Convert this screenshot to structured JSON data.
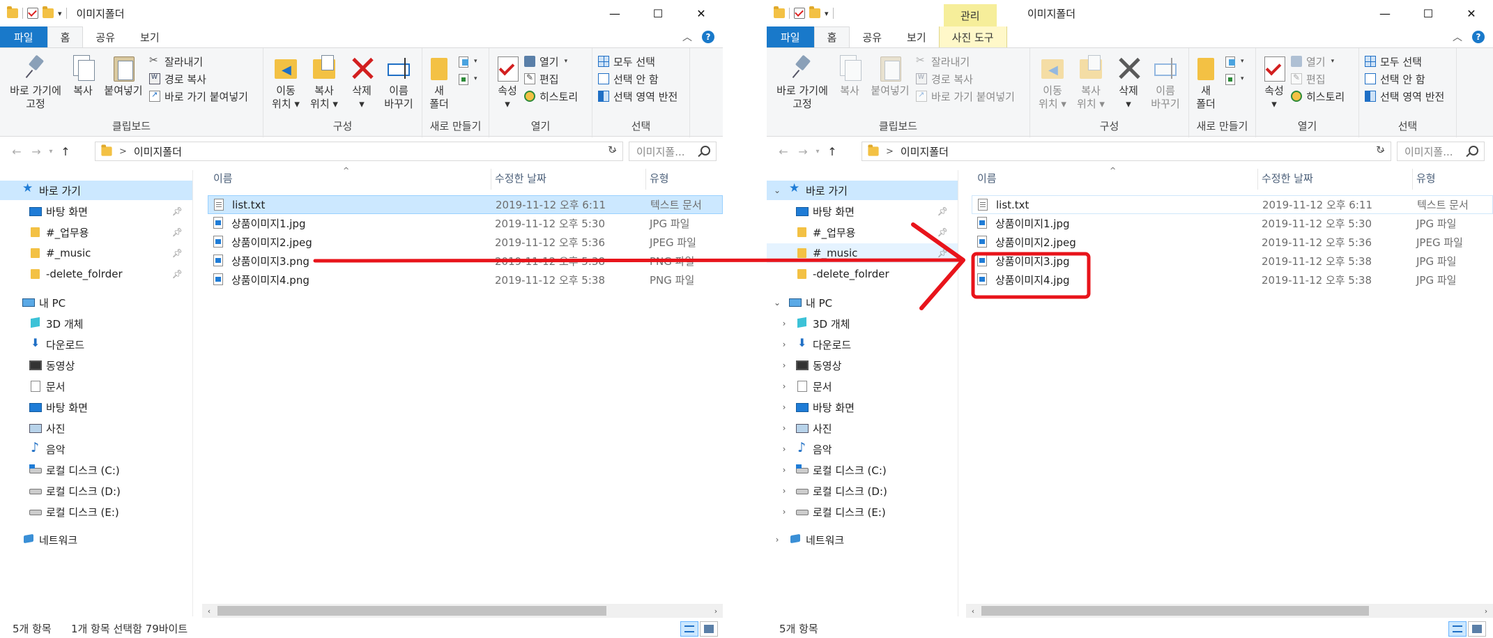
{
  "left": {
    "title": "이미지폴더",
    "tabs": [
      "파일",
      "홈",
      "공유",
      "보기"
    ],
    "clipboard": {
      "pin": "바로 가기에\n고정",
      "copy": "복사",
      "paste": "붙여넣기",
      "cut": "잘라내기",
      "copy_path": "경로 복사",
      "paste_shortcut": "바로 가기 붙여넣기",
      "label": "클립보드"
    },
    "organize": {
      "move_to": "이동\n위치 ▾",
      "copy_to": "복사\n위치 ▾",
      "delete": "삭제\n▾",
      "rename": "이름\n바꾸기",
      "label": "구성"
    },
    "new": {
      "new_folder": "새\n폴더",
      "label": "새로 만들기"
    },
    "open": {
      "properties": "속성\n▾",
      "open": "열기",
      "edit": "편집",
      "history": "히스토리",
      "label": "열기"
    },
    "select": {
      "select_all": "모두 선택",
      "select_none": "선택 안 함",
      "invert": "선택 영역 반전",
      "label": "선택"
    },
    "address": {
      "sep": ">",
      "path": "이미지폴더",
      "search_placeholder": "이미지폴..."
    },
    "nav": [
      {
        "label": "바로 가기",
        "icon": "star-icon"
      },
      {
        "label": "바탕 화면",
        "icon": "desktop-icon",
        "pinned": true
      },
      {
        "label": "#_업무용",
        "icon": "folder-icon",
        "pinned": true
      },
      {
        "label": "#_music",
        "icon": "folder-icon",
        "pinned": true
      },
      {
        "label": "-delete_folrder",
        "icon": "folder-icon",
        "pinned": true
      },
      {
        "label": "내 PC",
        "icon": "pc-icon"
      },
      {
        "label": "3D 개체",
        "icon": "3d-objects-icon"
      },
      {
        "label": "다운로드",
        "icon": "download-icon"
      },
      {
        "label": "동영상",
        "icon": "video-icon"
      },
      {
        "label": "문서",
        "icon": "document-icon"
      },
      {
        "label": "바탕 화면",
        "icon": "desktop-icon"
      },
      {
        "label": "사진",
        "icon": "pictures-icon"
      },
      {
        "label": "음악",
        "icon": "music-icon"
      },
      {
        "label": "로컬 디스크 (C:)",
        "icon": "disk-icon"
      },
      {
        "label": "로컬 디스크 (D:)",
        "icon": "disk-icon"
      },
      {
        "label": "로컬 디스크 (E:)",
        "icon": "disk-icon"
      },
      {
        "label": "네트워크",
        "icon": "network-icon"
      }
    ],
    "columns": {
      "name": "이름",
      "date": "수정한 날짜",
      "type": "유형"
    },
    "files": [
      {
        "name": "list.txt",
        "date": "2019-11-12 오후 6:11",
        "type": "텍스트 문서"
      },
      {
        "name": "상품이미지1.jpg",
        "date": "2019-11-12 오후 5:30",
        "type": "JPG 파일"
      },
      {
        "name": "상품이미지2.jpeg",
        "date": "2019-11-12 오후 5:36",
        "type": "JPEG 파일"
      },
      {
        "name": "상품이미지3.png",
        "date": "2019-11-12 오후 5:38",
        "type": "PNG 파일"
      },
      {
        "name": "상품이미지4.png",
        "date": "2019-11-12 오후 5:38",
        "type": "PNG 파일"
      }
    ],
    "status": {
      "count": "5개 항목",
      "selection": "1개 항목 선택함 79바이트"
    }
  },
  "right": {
    "title": "이미지폴더",
    "context_group": "관리",
    "tabs": [
      "파일",
      "홈",
      "공유",
      "보기",
      "사진 도구"
    ],
    "clipboard": {
      "pin": "바로 가기에\n고정",
      "copy": "복사",
      "paste": "붙여넣기",
      "cut": "잘라내기",
      "copy_path": "경로 복사",
      "paste_shortcut": "바로 가기 붙여넣기",
      "label": "클립보드"
    },
    "organize": {
      "move_to": "이동\n위치 ▾",
      "copy_to": "복사\n위치 ▾",
      "delete": "삭제\n▾",
      "rename": "이름\n바꾸기",
      "label": "구성"
    },
    "new": {
      "new_folder": "새\n폴더",
      "label": "새로 만들기"
    },
    "open": {
      "properties": "속성\n▾",
      "open": "열기",
      "edit": "편집",
      "history": "히스토리",
      "label": "열기"
    },
    "select": {
      "select_all": "모두 선택",
      "select_none": "선택 안 함",
      "invert": "선택 영역 반전",
      "label": "선택"
    },
    "address": {
      "sep": ">",
      "path": "이미지폴더",
      "search_placeholder": "이미지폴..."
    },
    "nav": [
      {
        "label": "바로 가기",
        "icon": "star-icon"
      },
      {
        "label": "바탕 화면",
        "icon": "desktop-icon",
        "pinned": true
      },
      {
        "label": "#_업무용",
        "icon": "folder-icon",
        "pinned": true
      },
      {
        "label": "#_music",
        "icon": "folder-icon",
        "pinned": true
      },
      {
        "label": "-delete_folrder",
        "icon": "folder-icon"
      },
      {
        "label": "내 PC",
        "icon": "pc-icon"
      },
      {
        "label": "3D 개체",
        "icon": "3d-objects-icon"
      },
      {
        "label": "다운로드",
        "icon": "download-icon"
      },
      {
        "label": "동영상",
        "icon": "video-icon"
      },
      {
        "label": "문서",
        "icon": "document-icon"
      },
      {
        "label": "바탕 화면",
        "icon": "desktop-icon"
      },
      {
        "label": "사진",
        "icon": "pictures-icon"
      },
      {
        "label": "음악",
        "icon": "music-icon"
      },
      {
        "label": "로컬 디스크 (C:)",
        "icon": "disk-icon"
      },
      {
        "label": "로컬 디스크 (D:)",
        "icon": "disk-icon"
      },
      {
        "label": "로컬 디스크 (E:)",
        "icon": "disk-icon"
      },
      {
        "label": "네트워크",
        "icon": "network-icon"
      }
    ],
    "columns": {
      "name": "이름",
      "date": "수정한 날짜",
      "type": "유형"
    },
    "files": [
      {
        "name": "list.txt",
        "date": "2019-11-12 오후 6:11",
        "type": "텍스트 문서"
      },
      {
        "name": "상품이미지1.jpg",
        "date": "2019-11-12 오후 5:30",
        "type": "JPG 파일"
      },
      {
        "name": "상품이미지2.jpeg",
        "date": "2019-11-12 오후 5:36",
        "type": "JPEG 파일"
      },
      {
        "name": "상품이미지3.jpg",
        "date": "2019-11-12 오후 5:38",
        "type": "JPG 파일"
      },
      {
        "name": "상품이미지4.jpg",
        "date": "2019-11-12 오후 5:38",
        "type": "JPG 파일"
      }
    ],
    "status": {
      "count": "5개 항목"
    }
  },
  "colors": {
    "file_tab": "#1979ca",
    "selection": "#cce8ff",
    "annotation_red": "#e8141b",
    "context_tab": "#f6ee9a"
  }
}
